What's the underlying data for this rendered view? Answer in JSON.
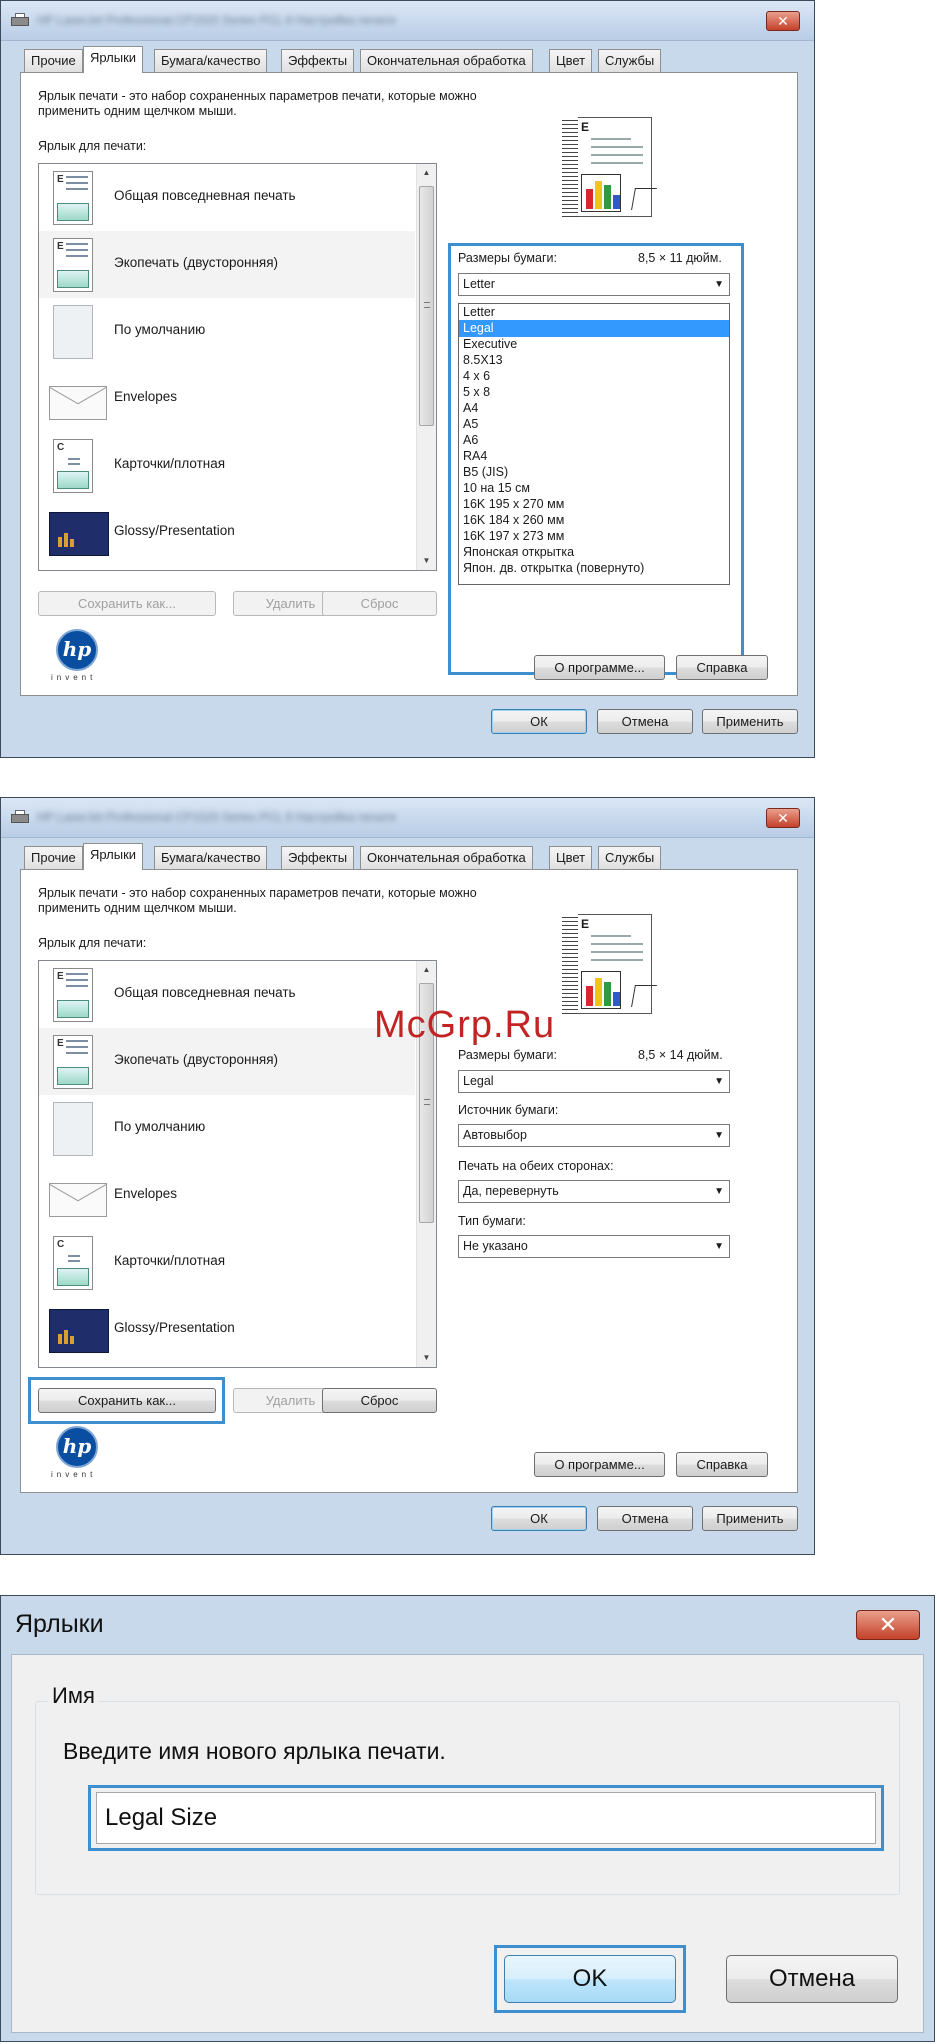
{
  "window": {
    "title_blurred": "HP LaserJet Professional CP1520 Series PCL 6 Настройка печати",
    "close_glyph": "✕"
  },
  "tabs": [
    "Прочие",
    "Ярлыки",
    "Бумага/качество",
    "Эффекты",
    "Окончательная обработка",
    "Цвет",
    "Службы"
  ],
  "active_tab": "Ярлыки",
  "description": "Ярлык печати - это набор сохраненных параметров печати, которые можно применить одним щелчком мыши.",
  "shortcuts_label": "Ярлык для печати:",
  "shortcuts": [
    {
      "label": "Общая повседневная печать",
      "icon": "document-picture-icon"
    },
    {
      "label": "Экопечать (двусторонняя)",
      "icon": "duplex-document-icon"
    },
    {
      "label": "По умолчанию",
      "icon": "blank-page-icon"
    },
    {
      "label": "Envelopes",
      "icon": "envelope-icon"
    },
    {
      "label": "Карточки/плотная",
      "icon": "card-icon"
    },
    {
      "label": "Glossy/Presentation",
      "icon": "presentation-icon"
    }
  ],
  "shortcut_buttons": {
    "save_as": "Сохранить как...",
    "delete": "Удалить",
    "reset": "Сброс"
  },
  "about_button": "О программе...",
  "help_button": "Справка",
  "footer_buttons": {
    "ok": "ОК",
    "cancel": "Отмена",
    "apply": "Применить"
  },
  "hp_logo": {
    "mark": "hp",
    "tagline": "invent"
  },
  "screen1": {
    "paper_size_label": "Размеры бумаги:",
    "paper_size_value": "8,5 × 11 дюйм.",
    "paper_size_selected": "Letter",
    "dropdown_options": [
      "Letter",
      "Legal",
      "Executive",
      "8.5X13",
      "4 x 6",
      "5 x 8",
      "A4",
      "A5",
      "A6",
      "RA4",
      "B5 (JIS)",
      "10 на 15 см",
      "16K 195 x 270 мм",
      "16K 184 x 260 мм",
      "16K 197 x 273 мм",
      "Японская открытка",
      "Япон. дв. открытка (повернуто)"
    ],
    "highlighted_option": "Legal"
  },
  "screen2": {
    "paper_size_label": "Размеры бумаги:",
    "paper_size_value": "8,5 × 14 дюйм.",
    "paper_size_selected": "Legal",
    "paper_source_label": "Источник бумаги:",
    "paper_source_selected": "Автовыбор",
    "duplex_label": "Печать на обеих сторонах:",
    "duplex_selected": "Да, перевернуть",
    "paper_type_label": "Тип бумаги:",
    "paper_type_selected": "Не указано"
  },
  "watermark": "McGrp.Ru",
  "dialog": {
    "title": "Ярлыки",
    "close_glyph": "✕",
    "group_label": "Имя",
    "prompt": "Введите имя нового ярлыка печати.",
    "input_value": "Legal Size",
    "ok": "OK",
    "cancel": "Отмена"
  },
  "colors": {
    "callout": "#3d8fcf",
    "selection": "#3399ff",
    "window_frame": "#c9d9ec",
    "close_button": "#c4412a"
  }
}
